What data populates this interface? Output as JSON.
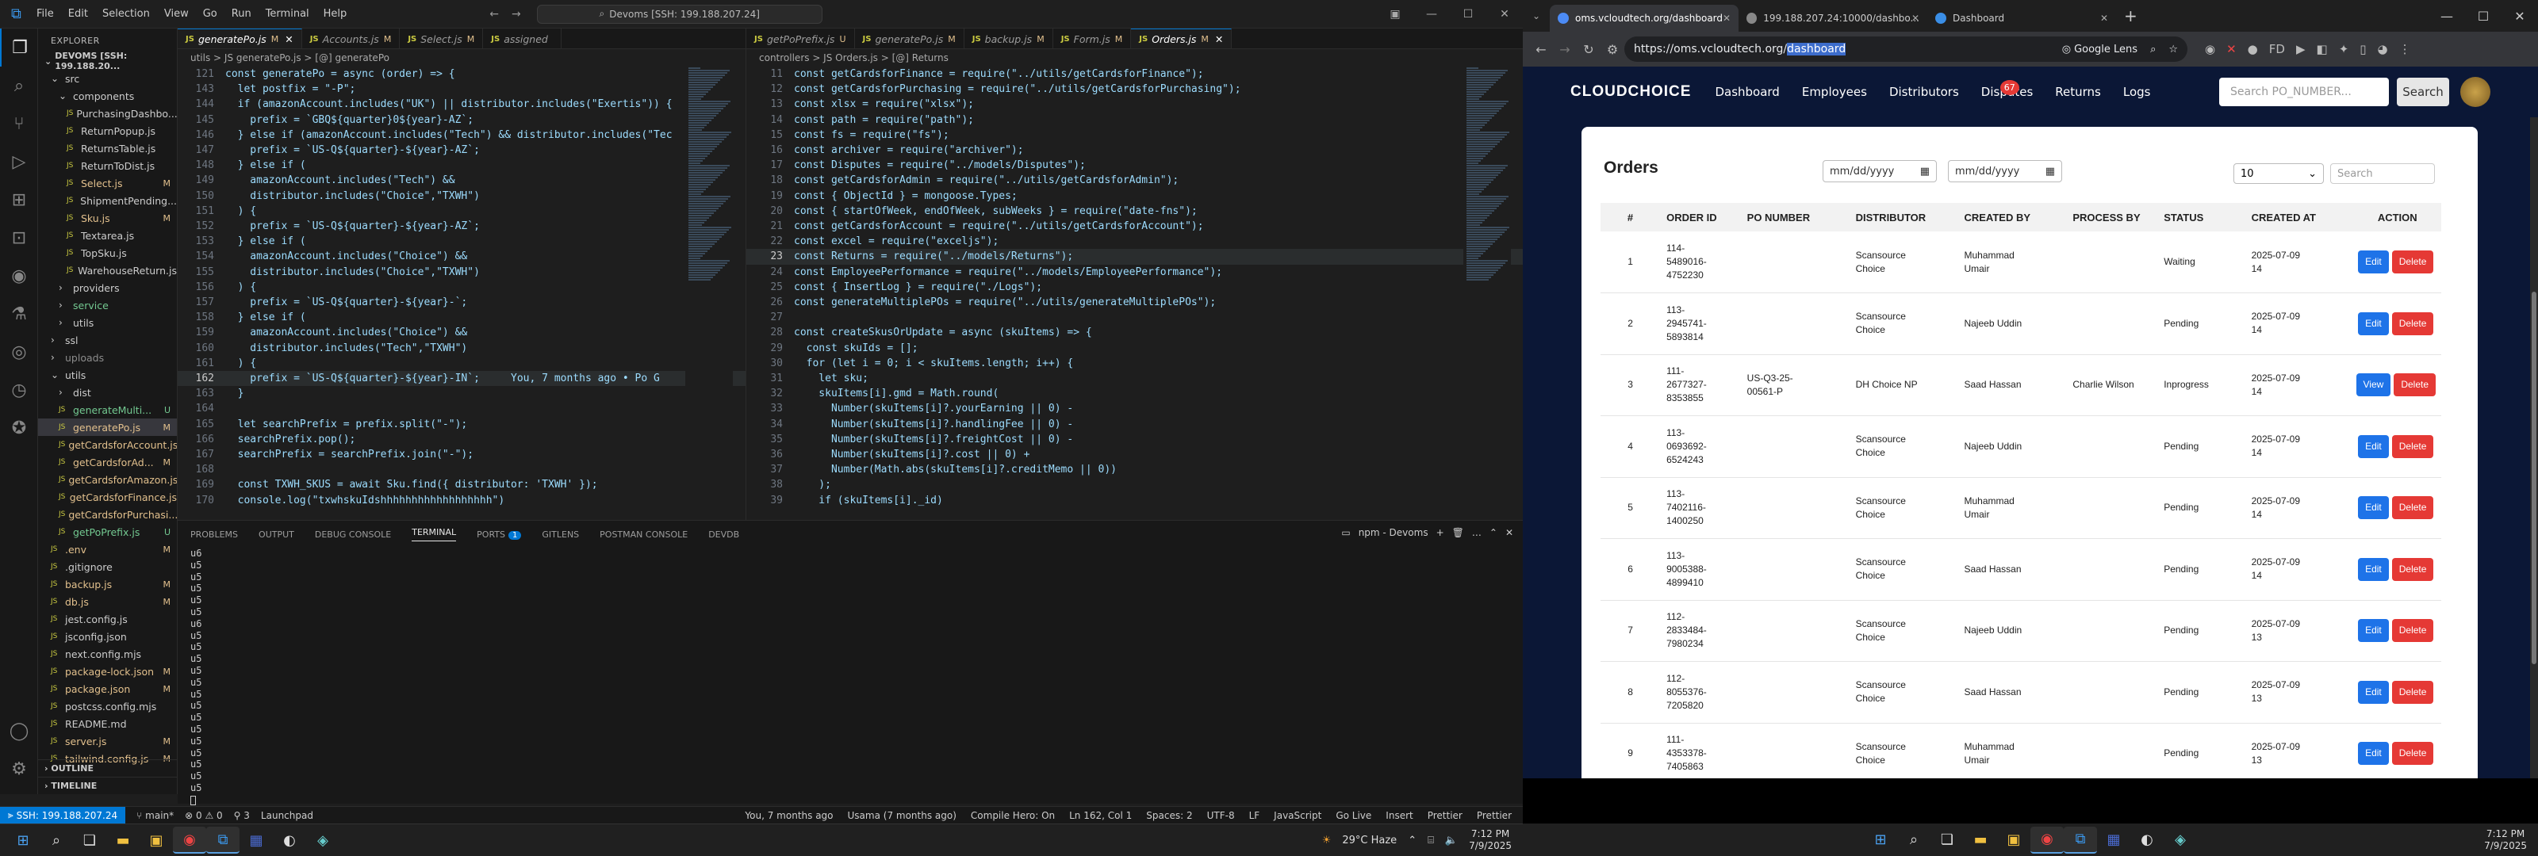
{
  "vscode": {
    "menu": [
      "File",
      "Edit",
      "Selection",
      "View",
      "Go",
      "Run",
      "Terminal",
      "Help"
    ],
    "command_center": "Devoms [SSH: 199.188.207.24]",
    "explorer_title": "EXPLORER",
    "root_label": "DEVOMS [SSH: 199.188.20...",
    "tree": [
      {
        "label": "src",
        "indent": 1,
        "type": "folder-open",
        "state": "",
        "status": ""
      },
      {
        "label": "components",
        "indent": 2,
        "type": "folder-open",
        "state": "",
        "status": ""
      },
      {
        "label": "PurchasingDashbo...",
        "indent": 3,
        "type": "file",
        "state": "",
        "status": ""
      },
      {
        "label": "ReturnPopup.js",
        "indent": 3,
        "type": "file",
        "state": "",
        "status": ""
      },
      {
        "label": "ReturnsTable.js",
        "indent": 3,
        "type": "file",
        "state": "",
        "status": ""
      },
      {
        "label": "ReturnToDist.js",
        "indent": 3,
        "type": "file",
        "state": "",
        "status": ""
      },
      {
        "label": "Select.js",
        "indent": 3,
        "type": "file",
        "state": "mod",
        "status": "M"
      },
      {
        "label": "ShipmentPending...",
        "indent": 3,
        "type": "file",
        "state": "",
        "status": ""
      },
      {
        "label": "Sku.js",
        "indent": 3,
        "type": "file",
        "state": "mod",
        "status": "M"
      },
      {
        "label": "Textarea.js",
        "indent": 3,
        "type": "file",
        "state": "",
        "status": ""
      },
      {
        "label": "TopSku.js",
        "indent": 3,
        "type": "file",
        "state": "",
        "status": ""
      },
      {
        "label": "WarehouseReturn.js",
        "indent": 3,
        "type": "file",
        "state": "",
        "status": ""
      },
      {
        "label": "providers",
        "indent": 2,
        "type": "folder",
        "state": "",
        "status": ""
      },
      {
        "label": "service",
        "indent": 2,
        "type": "folder",
        "state": "unt",
        "status": ""
      },
      {
        "label": "utils",
        "indent": 2,
        "type": "folder",
        "state": "",
        "status": ""
      },
      {
        "label": "ssl",
        "indent": 1,
        "type": "folder",
        "state": "",
        "status": ""
      },
      {
        "label": "uploads",
        "indent": 1,
        "type": "folder",
        "state": "ign",
        "status": ""
      },
      {
        "label": "utils",
        "indent": 1,
        "type": "folder-open",
        "state": "",
        "status": ""
      },
      {
        "label": "dist",
        "indent": 2,
        "type": "folder",
        "state": "",
        "status": ""
      },
      {
        "label": "generateMulti...",
        "indent": 2,
        "type": "file",
        "state": "unt",
        "status": "U"
      },
      {
        "label": "generatePo.js",
        "indent": 2,
        "type": "file",
        "state": "mod",
        "status": "M"
      },
      {
        "label": "getCardsforAccount.js",
        "indent": 2,
        "type": "file",
        "state": "mod",
        "status": ""
      },
      {
        "label": "getCardsforAd...",
        "indent": 2,
        "type": "file",
        "state": "mod",
        "status": "M"
      },
      {
        "label": "getCardsforAmazon.js",
        "indent": 2,
        "type": "file",
        "state": "mod",
        "status": ""
      },
      {
        "label": "getCardsforFinance.js",
        "indent": 2,
        "type": "file",
        "state": "mod",
        "status": ""
      },
      {
        "label": "getCardsforPurchasi...",
        "indent": 2,
        "type": "file",
        "state": "mod",
        "status": ""
      },
      {
        "label": "getPoPrefix.js",
        "indent": 2,
        "type": "file",
        "state": "unt",
        "status": "U"
      },
      {
        "label": ".env",
        "indent": 1,
        "type": "file",
        "state": "mod",
        "status": "M"
      },
      {
        "label": ".gitignore",
        "indent": 1,
        "type": "file",
        "state": "",
        "status": ""
      },
      {
        "label": "backup.js",
        "indent": 1,
        "type": "file",
        "state": "mod",
        "status": "M"
      },
      {
        "label": "db.js",
        "indent": 1,
        "type": "file",
        "state": "mod",
        "status": "M"
      },
      {
        "label": "jest.config.js",
        "indent": 1,
        "type": "file",
        "state": "",
        "status": ""
      },
      {
        "label": "jsconfig.json",
        "indent": 1,
        "type": "file",
        "state": "",
        "status": ""
      },
      {
        "label": "next.config.mjs",
        "indent": 1,
        "type": "file",
        "state": "",
        "status": ""
      },
      {
        "label": "package-lock.json",
        "indent": 1,
        "type": "file",
        "state": "mod",
        "status": "M"
      },
      {
        "label": "package.json",
        "indent": 1,
        "type": "file",
        "state": "mod",
        "status": "M"
      },
      {
        "label": "postcss.config.mjs",
        "indent": 1,
        "type": "file",
        "state": "",
        "status": ""
      },
      {
        "label": "README.md",
        "indent": 1,
        "type": "file",
        "state": "",
        "status": ""
      },
      {
        "label": "server.js",
        "indent": 1,
        "type": "file",
        "state": "mod",
        "status": "M"
      },
      {
        "label": "tailwind.config.js",
        "indent": 1,
        "type": "file",
        "state": "mod",
        "status": "M"
      }
    ],
    "outline": "OUTLINE",
    "timeline": "TIMELINE",
    "left_tabs": [
      {
        "label": "generatePo.js",
        "mod": "M",
        "active": true
      },
      {
        "label": "Accounts.js",
        "mod": "M",
        "active": false
      },
      {
        "label": "Select.js",
        "mod": "M",
        "active": false
      },
      {
        "label": "assigned",
        "mod": "",
        "active": false
      }
    ],
    "left_breadcrumb": "utils > JS generatePo.js > [@] generatePo",
    "left_code": [
      {
        "n": "121",
        "t": "const generatePo = async (order) => {"
      },
      {
        "n": "143",
        "t": "  let postfix = \"-P\";"
      },
      {
        "n": "144",
        "t": "  if (amazonAccount.includes(\"UK\") || distributor.includes(\"Exertis\")) {"
      },
      {
        "n": "145",
        "t": "    prefix = `GBQ${quarter}0${year}-AZ`;"
      },
      {
        "n": "146",
        "t": "  } else if (amazonAccount.includes(\"Tech\") && distributor.includes(\"Tec"
      },
      {
        "n": "147",
        "t": "    prefix = `US-Q${quarter}-${year}-AZ`;"
      },
      {
        "n": "148",
        "t": "  } else if ("
      },
      {
        "n": "149",
        "t": "    amazonAccount.includes(\"Tech\") &&"
      },
      {
        "n": "150",
        "t": "    distributor.includes(\"Choice\",\"TXWH\")"
      },
      {
        "n": "151",
        "t": "  ) {"
      },
      {
        "n": "152",
        "t": "    prefix = `US-Q${quarter}-${year}-AZ`;"
      },
      {
        "n": "153",
        "t": "  } else if ("
      },
      {
        "n": "154",
        "t": "    amazonAccount.includes(\"Choice\") &&"
      },
      {
        "n": "155",
        "t": "    distributor.includes(\"Choice\",\"TXWH\")"
      },
      {
        "n": "156",
        "t": "  ) {"
      },
      {
        "n": "157",
        "t": "    prefix = `US-Q${quarter}-${year}-`;"
      },
      {
        "n": "158",
        "t": "  } else if ("
      },
      {
        "n": "159",
        "t": "    amazonAccount.includes(\"Choice\") &&"
      },
      {
        "n": "160",
        "t": "    distributor.includes(\"Tech\",\"TXWH\")"
      },
      {
        "n": "161",
        "t": "  ) {"
      },
      {
        "n": "162",
        "t": "    prefix = `US-Q${quarter}-${year}-IN`;     You, 7 months ago • Po G"
      },
      {
        "n": "163",
        "t": "  }"
      },
      {
        "n": "164",
        "t": ""
      },
      {
        "n": "165",
        "t": "  let searchPrefix = prefix.split(\"-\");"
      },
      {
        "n": "166",
        "t": "  searchPrefix.pop();"
      },
      {
        "n": "167",
        "t": "  searchPrefix = searchPrefix.join(\"-\");"
      },
      {
        "n": "168",
        "t": ""
      },
      {
        "n": "169",
        "t": "  const TXWH_SKUS = await Sku.find({ distributor: 'TXWH' });"
      },
      {
        "n": "170",
        "t": "  console.log(\"txwhskuIdshhhhhhhhhhhhhhhhhh\")"
      }
    ],
    "right_tabs": [
      {
        "label": "getPoPrefix.js",
        "mod": "U",
        "active": false
      },
      {
        "label": "generatePo.js",
        "mod": "M",
        "active": false
      },
      {
        "label": "backup.js",
        "mod": "M",
        "active": false
      },
      {
        "label": "Form.js",
        "mod": "M",
        "active": false
      },
      {
        "label": "Orders.js",
        "mod": "M",
        "active": true
      }
    ],
    "right_breadcrumb": "controllers > JS Orders.js > [@] Returns",
    "right_code": [
      {
        "n": "11",
        "t": "const getCardsforFinance = require(\"../utils/getCardsforFinance\");"
      },
      {
        "n": "12",
        "t": "const getCardsforPurchasing = require(\"../utils/getCardsforPurchasing\");"
      },
      {
        "n": "13",
        "t": "const xlsx = require(\"xlsx\");"
      },
      {
        "n": "14",
        "t": "const path = require(\"path\");"
      },
      {
        "n": "15",
        "t": "const fs = require(\"fs\");"
      },
      {
        "n": "16",
        "t": "const archiver = require(\"archiver\");"
      },
      {
        "n": "17",
        "t": "const Disputes = require(\"../models/Disputes\");"
      },
      {
        "n": "18",
        "t": "const getCardsforAdmin = require(\"../utils/getCardsforAdmin\");"
      },
      {
        "n": "19",
        "t": "const { ObjectId } = mongoose.Types;"
      },
      {
        "n": "20",
        "t": "const { startOfWeek, endOfWeek, subWeeks } = require(\"date-fns\");"
      },
      {
        "n": "21",
        "t": "const getCardsforAccount = require(\"../utils/getCardsforAccount\");"
      },
      {
        "n": "22",
        "t": "const excel = require(\"exceljs\");"
      },
      {
        "n": "23",
        "t": "const Returns = require(\"../models/Returns\");"
      },
      {
        "n": "24",
        "t": "const EmployeePerformance = require(\"../models/EmployeePerformance\");"
      },
      {
        "n": "25",
        "t": "const { InsertLog } = require(\"./Logs\");"
      },
      {
        "n": "26",
        "t": "const generateMultiplePOs = require(\"../utils/generateMultiplePOs\");"
      },
      {
        "n": "27",
        "t": ""
      },
      {
        "n": "28",
        "t": "const createSkusOrUpdate = async (skuItems) => {"
      },
      {
        "n": "29",
        "t": "  const skuIds = [];"
      },
      {
        "n": "30",
        "t": "  for (let i = 0; i < skuItems.length; i++) {"
      },
      {
        "n": "31",
        "t": "    let sku;"
      },
      {
        "n": "32",
        "t": "    skuItems[i].gmd = Math.round("
      },
      {
        "n": "33",
        "t": "      Number(skuItems[i]?.yourEarning || 0) -"
      },
      {
        "n": "34",
        "t": "      Number(skuItems[i]?.handlingFee || 0) -"
      },
      {
        "n": "35",
        "t": "      Number(skuItems[i]?.freightCost || 0) -"
      },
      {
        "n": "36",
        "t": "      Number(skuItems[i]?.cost || 0) +"
      },
      {
        "n": "37",
        "t": "      Number(Math.abs(skuItems[i]?.creditMemo || 0))"
      },
      {
        "n": "38",
        "t": "    );"
      },
      {
        "n": "39",
        "t": "    if (skuItems[i]._id)"
      }
    ],
    "panel_tabs": [
      "PROBLEMS",
      "OUTPUT",
      "DEBUG CONSOLE",
      "TERMINAL",
      "PORTS",
      "GITLENS",
      "POSTMAN CONSOLE",
      "DEVDB"
    ],
    "ports_badge": "1",
    "terminal_name": "npm - Devoms",
    "terminal_lines": [
      "u6",
      "u5",
      "u5",
      "u5",
      "u5",
      "u5",
      "u6",
      "u5",
      "u5",
      "u5",
      "u5",
      "u5",
      "u5",
      "u5",
      "u5",
      "u5",
      "u5",
      "u5",
      "u5",
      "u5",
      "u5"
    ],
    "status": {
      "remote": "SSH: 199.188.207.24",
      "branch": "main*",
      "errors": "⊗ 0 ⚠ 0",
      "ports": "3",
      "launchpad": "Launchpad",
      "blame": "You, 7 months ago",
      "author": "Usama (7 months ago)",
      "compile": "Compile Hero: On",
      "position": "Ln 162, Col 1",
      "spaces": "Spaces: 2",
      "encoding": "UTF-8",
      "eol": "LF",
      "language": "JavaScript",
      "golive": "Go Live",
      "insert": "Insert",
      "prettier": "Prettier",
      "prettier2": "Prettier"
    }
  },
  "browser": {
    "tabs": [
      {
        "label": "oms.vcloudtech.org/dashboard",
        "active": true
      },
      {
        "label": "199.188.207.24:10000/dashbo...",
        "active": false
      },
      {
        "label": "Dashboard",
        "active": false
      }
    ],
    "url_prefix": "https://oms.vcloudtech.org/",
    "url_selected": "dashboard",
    "lens": "Google Lens",
    "site": {
      "brand": "CLOUDCHOICE",
      "nav": [
        "Dashboard",
        "Employees",
        "Distributors",
        "Disputes",
        "Returns",
        "Logs"
      ],
      "disputes_badge": "67",
      "search_placeholder": "Search PO_NUMBER...",
      "search_button": "Search"
    },
    "orders": {
      "title": "Orders",
      "date_placeholder_1": "mm/dd/yyyy",
      "date_placeholder_2": "mm/dd/yyyy",
      "page_size": "10",
      "search_placeholder": "Search",
      "columns": [
        "#",
        "ORDER ID",
        "PO NUMBER",
        "DISTRIBUTOR",
        "CREATED BY",
        "PROCESS BY",
        "STATUS",
        "CREATED AT",
        "ACTION"
      ],
      "rows": [
        {
          "n": "1",
          "order_id": "114-\n5489016-\n4752230",
          "po": "",
          "distributor": "Scansource\nChoice",
          "created_by": "Muhammad\nUmair",
          "process_by": "",
          "status": "Waiting",
          "created_at": "2025-07-09\n14",
          "action": "Edit"
        },
        {
          "n": "2",
          "order_id": "113-\n2945741-\n5893814",
          "po": "",
          "distributor": "Scansource\nChoice",
          "created_by": "Najeeb Uddin",
          "process_by": "",
          "status": "Pending",
          "created_at": "2025-07-09\n14",
          "action": "Edit"
        },
        {
          "n": "3",
          "order_id": "111-\n2677327-\n8353855",
          "po": "US-Q3-25-\n00561-P",
          "distributor": "DH Choice NP",
          "created_by": "Saad Hassan",
          "process_by": "Charlie Wilson",
          "status": "Inprogress",
          "created_at": "2025-07-09\n14",
          "action": "View"
        },
        {
          "n": "4",
          "order_id": "113-\n0693692-\n6524243",
          "po": "",
          "distributor": "Scansource\nChoice",
          "created_by": "Najeeb Uddin",
          "process_by": "",
          "status": "Pending",
          "created_at": "2025-07-09\n14",
          "action": "Edit"
        },
        {
          "n": "5",
          "order_id": "113-\n7402116-\n1400250",
          "po": "",
          "distributor": "Scansource\nChoice",
          "created_by": "Muhammad\nUmair",
          "process_by": "",
          "status": "Pending",
          "created_at": "2025-07-09\n14",
          "action": "Edit"
        },
        {
          "n": "6",
          "order_id": "113-\n9005388-\n4899410",
          "po": "",
          "distributor": "Scansource\nChoice",
          "created_by": "Saad Hassan",
          "process_by": "",
          "status": "Pending",
          "created_at": "2025-07-09\n14",
          "action": "Edit"
        },
        {
          "n": "7",
          "order_id": "112-\n2833484-\n7980234",
          "po": "",
          "distributor": "Scansource\nChoice",
          "created_by": "Najeeb Uddin",
          "process_by": "",
          "status": "Pending",
          "created_at": "2025-07-09\n13",
          "action": "Edit"
        },
        {
          "n": "8",
          "order_id": "112-\n8055376-\n7205820",
          "po": "",
          "distributor": "Scansource\nChoice",
          "created_by": "Saad Hassan",
          "process_by": "",
          "status": "Pending",
          "created_at": "2025-07-09\n13",
          "action": "Edit"
        },
        {
          "n": "9",
          "order_id": "111-\n4353378-\n7405863",
          "po": "",
          "distributor": "Scansource\nChoice",
          "created_by": "Muhammad\nUmair",
          "process_by": "",
          "status": "Pending",
          "created_at": "2025-07-09\n13",
          "action": "Edit"
        }
      ],
      "delete_label": "Delete"
    }
  },
  "taskbar_right": {
    "time": "7:12 PM",
    "date": "7/9/2025"
  },
  "taskbar_left": {
    "weather": "29°C Haze",
    "time": "7:12 PM",
    "date": "7/9/2025"
  }
}
